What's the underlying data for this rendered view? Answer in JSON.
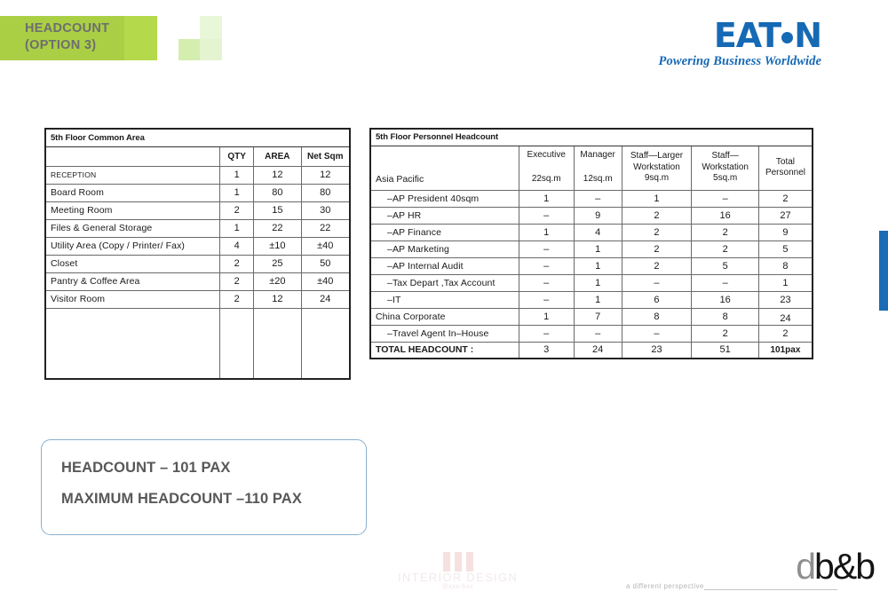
{
  "header": {
    "title": "HEADCOUNT\n(OPTION 3)",
    "accent_green": "#b4d94b",
    "accent_green_dark": "#aacf45"
  },
  "brand": {
    "name_part_1": "EAT",
    "name_part_2": "N",
    "dot_icon": "eaton-dot-icon",
    "tagline": "Powering Business Worldwide",
    "color": "#1669b5"
  },
  "edge_tab": {
    "color": "#1a6cb5"
  },
  "common_area_table": {
    "title": "5th Floor Common Area",
    "columns": [
      "5th Floor Common Area",
      "QTY",
      "AREA",
      "Net  Sqm"
    ],
    "rows": [
      {
        "name": "RECEPTION",
        "qty": "1",
        "area": "12",
        "net": "12",
        "style": "small"
      },
      {
        "name": "Board  Room",
        "qty": "1",
        "area": "80",
        "net": "80",
        "style": "normal"
      },
      {
        "name": "Meeting  Room",
        "qty": "2",
        "area": "15",
        "net": "30",
        "style": "normal"
      },
      {
        "name": "Files  &  General  Storage",
        "qty": "1",
        "area": "22",
        "net": "22",
        "style": "normal"
      },
      {
        "name": "Utility Area (Copy  /  Printer/ Fax)",
        "qty": "4",
        "area": "±10",
        "net": "±40",
        "style": "normal"
      },
      {
        "name": "Closet",
        "qty": "2",
        "area": "25",
        "net": "50",
        "style": "normal"
      },
      {
        "name": "Pantry  &  Coffee  Area",
        "qty": "2",
        "area": "±20",
        "net": "±40",
        "style": "normal"
      },
      {
        "name": "Visitor  Room",
        "qty": "2",
        "area": "12",
        "net": "24",
        "style": "normal"
      }
    ]
  },
  "headcount_table": {
    "title": "5th Floor Personnel Headcount",
    "region_label": "Asia  Pacific",
    "columns": [
      {
        "line1": "Executive",
        "line2": "22sq.m"
      },
      {
        "line1": "Manager",
        "line2": "12sq.m"
      },
      {
        "line1": "Staff—Larger",
        "line2": "Workstation",
        "line3": "9sq.m"
      },
      {
        "line1": "Staff—",
        "line2": "Workstation",
        "line3": "5sq.m"
      },
      {
        "line1": "Total",
        "line2": "Personnel"
      }
    ],
    "rows": [
      {
        "name": "–AP  President  40sqm",
        "indent": true,
        "executive": "1",
        "manager": "–",
        "staff_larger": "1",
        "staff_ws": "–",
        "total": "2"
      },
      {
        "name": "–AP  HR",
        "indent": true,
        "executive": "–",
        "manager": "9",
        "staff_larger": "2",
        "staff_ws": "16",
        "total": "27"
      },
      {
        "name": "–AP  Finance",
        "indent": true,
        "executive": "1",
        "manager": "4",
        "staff_larger": "2",
        "staff_ws": "2",
        "total": "9"
      },
      {
        "name": "–AP  Marketing",
        "indent": true,
        "executive": "–",
        "manager": "1",
        "staff_larger": "2",
        "staff_ws": "2",
        "total": "5"
      },
      {
        "name": "–AP  Internal  Audit",
        "indent": true,
        "executive": "–",
        "manager": "1",
        "staff_larger": "2",
        "staff_ws": "5",
        "total": "8"
      },
      {
        "name": "–Tax  Depart ,Tax  Account",
        "indent": true,
        "executive": "–",
        "manager": "1",
        "staff_larger": "–",
        "staff_ws": "–",
        "total": "1"
      },
      {
        "name": "–IT",
        "indent": true,
        "executive": "–",
        "manager": "1",
        "staff_larger": "6",
        "staff_ws": "16",
        "total": "23"
      },
      {
        "name": "China  Corporate",
        "indent": false,
        "executive": "1",
        "manager": "7",
        "staff_larger": "8",
        "staff_ws": "8",
        "total": "24"
      },
      {
        "name": "–Travel  Agent  In–House",
        "indent": true,
        "executive": "–",
        "manager": "–",
        "staff_larger": "–",
        "staff_ws": "2",
        "total": "2"
      }
    ],
    "total_row": {
      "label": "TOTAL HEADCOUNT :",
      "executive": "3",
      "manager": "24",
      "staff_larger": "23",
      "staff_ws": "51",
      "total": "101pax"
    }
  },
  "callout": {
    "line_1": "HEADCOUNT – 101 PAX",
    "line_2": "MAXIMUM HEADCOUNT –110 PAX",
    "border_color": "#8ab0cf",
    "text_color": "#58585a"
  },
  "footer": {
    "interior_design": {
      "mark_icon": "three-bars-icon",
      "name": "INTERIOR DESIGN",
      "sub": "@xxx-box"
    },
    "dbb": {
      "tagline": "a different perspective",
      "logo_d": "d",
      "logo_rest": "b&b"
    }
  }
}
